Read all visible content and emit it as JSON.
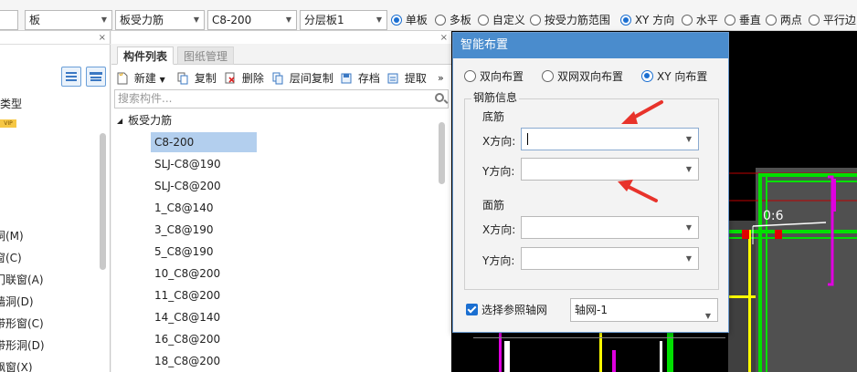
{
  "toolbar": {
    "combo_type": "板",
    "combo_category": "板受力筋",
    "combo_spec": "C8-200",
    "combo_layer": "分层板1",
    "radios": [
      {
        "label": "单板",
        "checked": true
      },
      {
        "label": "多板",
        "checked": false
      },
      {
        "label": "自定义",
        "checked": false
      },
      {
        "label": "按受力筋范围",
        "checked": false
      },
      {
        "label": "XY 方向",
        "checked": true
      },
      {
        "label": "水平",
        "checked": false
      },
      {
        "label": "垂直",
        "checked": false
      },
      {
        "label": "两点",
        "checked": false
      },
      {
        "label": "平行边",
        "checked": false
      }
    ]
  },
  "left_panel": {
    "close": "×",
    "tag": "VIP",
    "items": [
      "类型",
      "洞(M)",
      "窗(C)",
      "门联窗(A)",
      "墙洞(D)",
      "带形窗(C)",
      "带形洞(D)",
      "飘窗(X)"
    ]
  },
  "component_panel": {
    "close": "×",
    "tabs": [
      "构件列表",
      "图纸管理"
    ],
    "tools": [
      "新建",
      "复制",
      "删除",
      "层间复制",
      "存档",
      "提取"
    ],
    "more": "»",
    "search_placeholder": "搜索构件...",
    "root": "板受力筋",
    "items": [
      {
        "label": "C8-200",
        "selected": true
      },
      {
        "label": "SLJ-C8@190",
        "selected": false
      },
      {
        "label": "SLJ-C8@200",
        "selected": false
      },
      {
        "label": "1_C8@140",
        "selected": false
      },
      {
        "label": "3_C8@190",
        "selected": false
      },
      {
        "label": "5_C8@190",
        "selected": false
      },
      {
        "label": "10_C8@200",
        "selected": false
      },
      {
        "label": "11_C8@200",
        "selected": false
      },
      {
        "label": "14_C8@140",
        "selected": false
      },
      {
        "label": "16_C8@200",
        "selected": false
      },
      {
        "label": "18_C8@200",
        "selected": false
      }
    ]
  },
  "canvas": {
    "label": "0:6"
  },
  "dialog": {
    "title": "智能布置",
    "modes": [
      {
        "label": "双向布置",
        "checked": false
      },
      {
        "label": "双网双向布置",
        "checked": false
      },
      {
        "label": "XY 向布置",
        "checked": true
      }
    ],
    "group_title": "钢筋信息",
    "bottom_title": "底筋",
    "top_title": "面筋",
    "x_label": "X方向:",
    "y_label": "Y方向:",
    "bottom_x_value": "",
    "bottom_y_value": "",
    "top_x_value": "",
    "top_y_value": "",
    "use_axis_label": "选择参照轴网",
    "use_axis_checked": true,
    "axis_value": "轴网-1"
  },
  "colors": {
    "dialog_title": "#4a8ccd",
    "selection": "#b3cfee",
    "annotation_arrow": "#e8332b",
    "rebar_green": "#00e000",
    "rebar_yellow": "#ffff00",
    "rebar_magenta": "#e000e0"
  }
}
